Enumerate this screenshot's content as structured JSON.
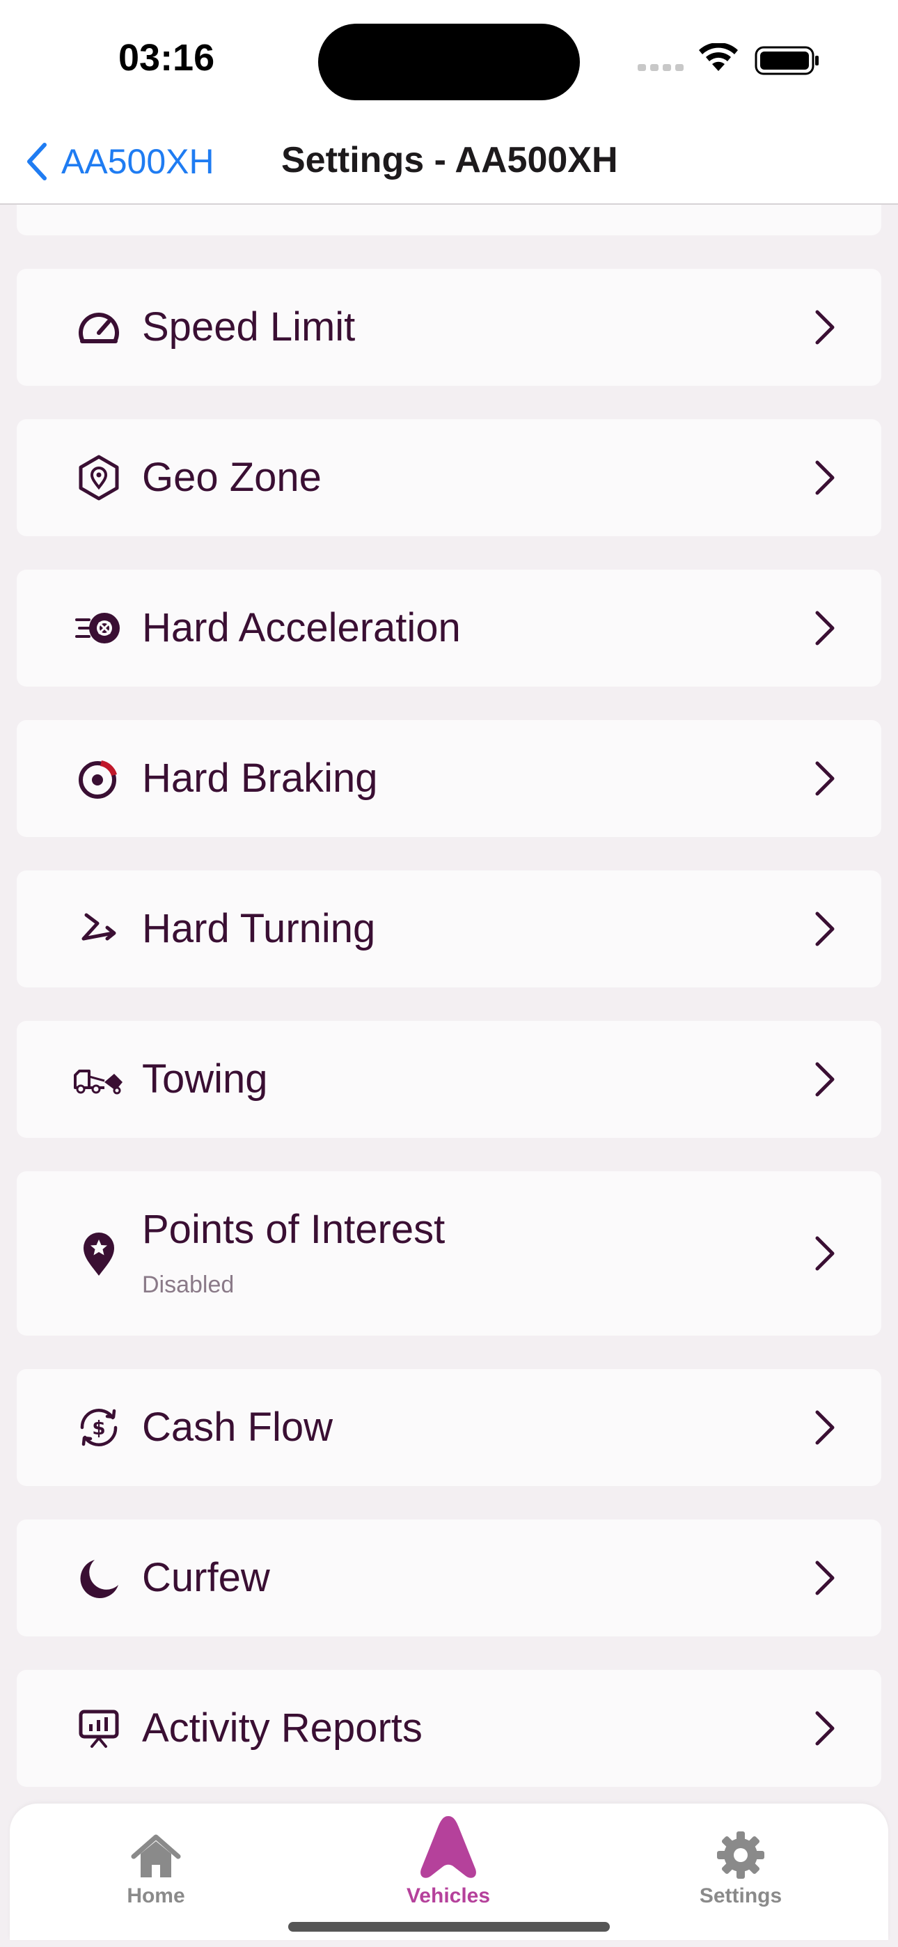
{
  "status": {
    "time": "03:16"
  },
  "nav": {
    "back_label": "AA500XH",
    "title": "Settings - AA500XH"
  },
  "items": [
    {
      "label": "Speed Limit",
      "icon": "speedometer-icon"
    },
    {
      "label": "Geo Zone",
      "icon": "geo-zone-icon"
    },
    {
      "label": "Hard Acceleration",
      "icon": "acceleration-icon"
    },
    {
      "label": "Hard Braking",
      "icon": "brake-icon"
    },
    {
      "label": "Hard Turning",
      "icon": "turning-icon"
    },
    {
      "label": "Towing",
      "icon": "tow-truck-icon"
    },
    {
      "label": "Points of Interest",
      "sublabel": "Disabled",
      "icon": "star-pin-icon"
    },
    {
      "label": "Cash Flow",
      "icon": "cash-flow-icon"
    },
    {
      "label": "Curfew",
      "icon": "moon-icon"
    },
    {
      "label": "Activity Reports",
      "icon": "presentation-chart-icon"
    }
  ],
  "tabs": [
    {
      "label": "Home",
      "icon": "home-icon"
    },
    {
      "label": "Vehicles",
      "icon": "vehicles-logo-icon"
    },
    {
      "label": "Settings",
      "icon": "gear-icon"
    }
  ],
  "colors": {
    "accent": "#b5419b",
    "text": "#3a0f33",
    "link": "#1f7cf2",
    "brake": "#c0182a"
  }
}
